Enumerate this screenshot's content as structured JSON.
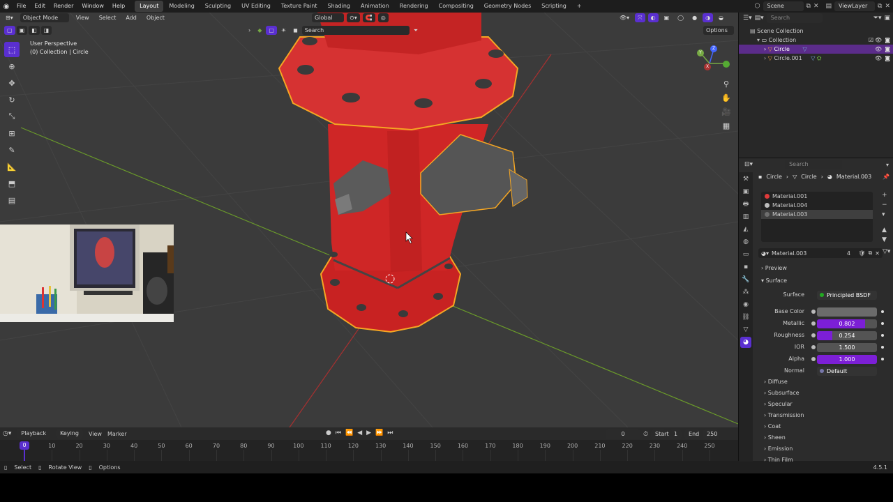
{
  "topbar": {
    "menus": [
      "File",
      "Edit",
      "Render",
      "Window",
      "Help"
    ],
    "workspaces": [
      "Layout",
      "Modeling",
      "Sculpting",
      "UV Editing",
      "Texture Paint",
      "Shading",
      "Animation",
      "Rendering",
      "Compositing",
      "Geometry Nodes",
      "Scripting"
    ],
    "active_workspace": "Layout",
    "add_tab": "+",
    "scene": "Scene",
    "view_layer": "ViewLayer"
  },
  "viewport": {
    "mode": "Object Mode",
    "menus": [
      "View",
      "Select",
      "Add",
      "Object"
    ],
    "orientation": "Global",
    "search_placeholder": "Search",
    "options": "Options",
    "perspective": "User Perspective",
    "collection_info": "(0) Collection | Circle",
    "gizmo": {
      "x": "X",
      "y": "Y",
      "z": "Z"
    }
  },
  "timeline": {
    "menus": [
      "Playback",
      "Keying",
      "View",
      "Marker"
    ],
    "current_frame": "0",
    "start_label": "Start",
    "start": "1",
    "end_label": "End",
    "end": "250",
    "ticks": [
      "0",
      "10",
      "20",
      "30",
      "40",
      "50",
      "60",
      "70",
      "80",
      "90",
      "100",
      "110",
      "120",
      "130",
      "140",
      "150",
      "160",
      "170",
      "180",
      "190",
      "200",
      "210",
      "220",
      "230",
      "240",
      "250"
    ]
  },
  "statusbar": {
    "items": [
      "Select",
      "Rotate View",
      "Options"
    ],
    "version": "4.5.1"
  },
  "outliner": {
    "search_placeholder": "Search",
    "rows": [
      {
        "label": "Scene Collection",
        "indent": 0,
        "selected": false
      },
      {
        "label": "Collection",
        "indent": 1,
        "selected": false
      },
      {
        "label": "Circle",
        "indent": 2,
        "selected": true
      },
      {
        "label": "Circle.001",
        "indent": 2,
        "selected": false
      }
    ]
  },
  "properties": {
    "search_placeholder": "Search",
    "breadcrumb": [
      "Circle",
      "Circle",
      "Material.003"
    ],
    "slots": [
      "Material.001",
      "Material.004",
      "Material.003"
    ],
    "slot_colors": [
      "#e03a3a",
      "#bdbdbd",
      "#6e6e6e"
    ],
    "material_name": "Material.003",
    "users": "4",
    "preview_label": "Preview",
    "surface_section": "Surface",
    "surface_label": "Surface",
    "surface_shader": "Principled BSDF",
    "base_color_label": "Base Color",
    "base_color": "#6b6b6b",
    "metallic_label": "Metallic",
    "metallic": "0.802",
    "roughness_label": "Roughness",
    "roughness": "0.254",
    "ior_label": "IOR",
    "ior": "1.500",
    "alpha_label": "Alpha",
    "alpha": "1.000",
    "normal_label": "Normal",
    "normal": "Default",
    "subpanels": [
      "Diffuse",
      "Subsurface",
      "Specular",
      "Transmission",
      "Coat",
      "Sheen",
      "Emission",
      "Thin Film"
    ]
  },
  "colors": {
    "accent": "#5a2fd0",
    "selection": "#5b2c8a",
    "hydrant_red": "#d42a2a",
    "outline_orange": "#f5a623"
  }
}
